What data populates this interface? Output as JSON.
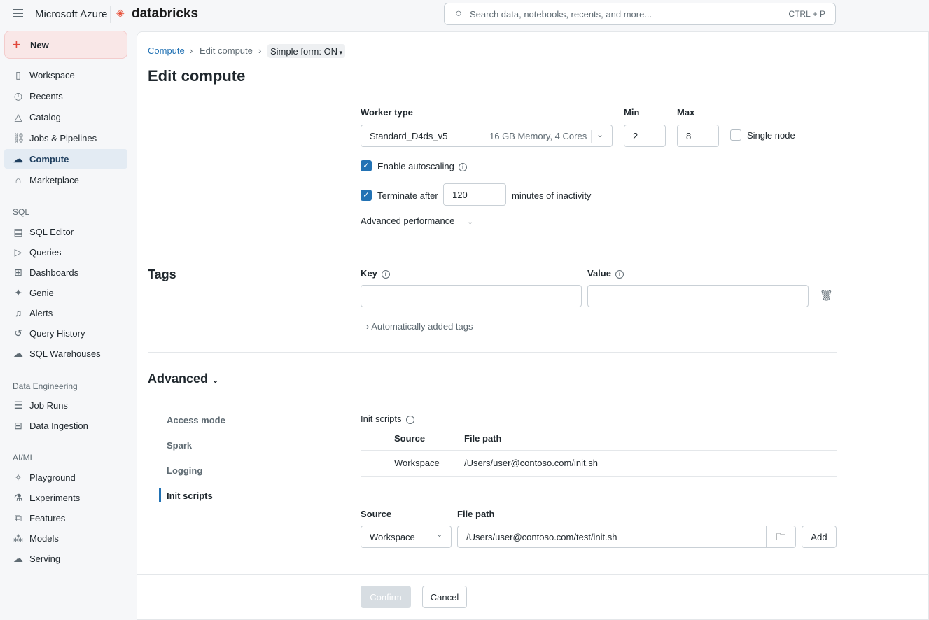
{
  "header": {
    "brand": "Microsoft Azure",
    "product": "databricks",
    "search_placeholder": "Search data, notebooks, recents, and more...",
    "search_shortcut": "CTRL + P"
  },
  "sidebar": {
    "new_label": "New",
    "items": [
      "Workspace",
      "Recents",
      "Catalog",
      "Jobs & Pipelines",
      "Compute",
      "Marketplace"
    ],
    "sql_header": "SQL",
    "sql_items": [
      "SQL Editor",
      "Queries",
      "Dashboards",
      "Genie",
      "Alerts",
      "Query History",
      "SQL Warehouses"
    ],
    "de_header": "Data Engineering",
    "de_items": [
      "Job Runs",
      "Data Ingestion"
    ],
    "ai_header": "AI/ML",
    "ai_items": [
      "Playground",
      "Experiments",
      "Features",
      "Models",
      "Serving"
    ]
  },
  "breadcrumb": {
    "root": "Compute",
    "current": "Edit compute",
    "form_toggle": "Simple form: ON"
  },
  "page_title": "Edit compute",
  "worker": {
    "label": "Worker type",
    "value": "Standard_D4ds_v5",
    "spec": "16 GB Memory, 4 Cores",
    "min_label": "Min",
    "min": "2",
    "max_label": "Max",
    "max": "8",
    "single_node": "Single node",
    "autoscaling": "Enable autoscaling",
    "terminate_label": "Terminate after",
    "terminate_value": "120",
    "terminate_suffix": "minutes of inactivity",
    "advanced_performance": "Advanced performance"
  },
  "tags": {
    "title": "Tags",
    "key_label": "Key",
    "value_label": "Value",
    "key": "",
    "value": "",
    "auto_tags": "Automatically added tags"
  },
  "advanced": {
    "title": "Advanced",
    "tabs": [
      "Access mode",
      "Spark",
      "Logging",
      "Init scripts"
    ],
    "init_scripts": {
      "label": "Init scripts",
      "col_source": "Source",
      "col_path": "File path",
      "rows": [
        {
          "source": "Workspace",
          "path": "/Users/user@contoso.com/init.sh"
        }
      ],
      "new_source_label": "Source",
      "new_path_label": "File path",
      "new_source": "Workspace",
      "new_path": "/Users/user@contoso.com/test/init.sh",
      "add_label": "Add"
    }
  },
  "footer": {
    "confirm": "Confirm",
    "cancel": "Cancel"
  }
}
